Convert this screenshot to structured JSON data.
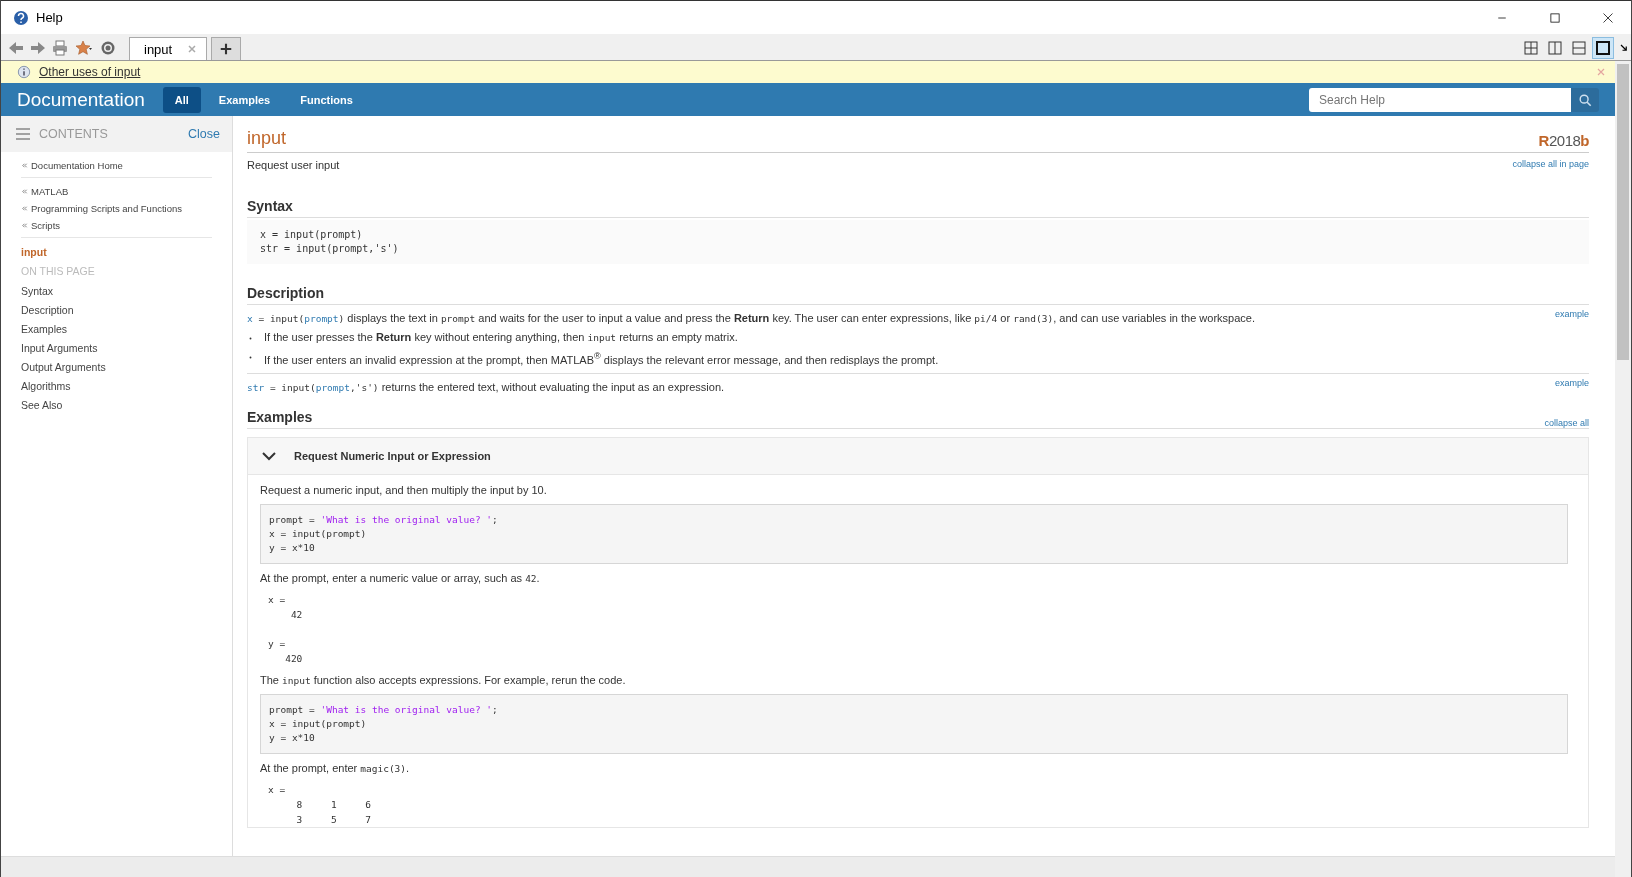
{
  "window": {
    "title": "Help"
  },
  "toolbar": {
    "tabs": [
      {
        "label": "input",
        "selected": true
      }
    ],
    "layouts": [
      {
        "kind": "grid",
        "selected": false
      },
      {
        "kind": "columns",
        "selected": false
      },
      {
        "kind": "rows",
        "selected": false
      },
      {
        "kind": "single",
        "selected": true
      }
    ]
  },
  "info_bar": {
    "link": "Other uses of input"
  },
  "header": {
    "title": "Documentation",
    "filters": [
      {
        "label": "All",
        "selected": true
      },
      {
        "label": "Examples",
        "selected": false
      },
      {
        "label": "Functions",
        "selected": false
      }
    ],
    "search": {
      "placeholder": "Search Help"
    }
  },
  "sidebar": {
    "title": "CONTENTS",
    "close": "Close",
    "breadcrumbs": [
      [
        {
          "label": "Documentation Home"
        }
      ],
      [
        {
          "label": "MATLAB"
        },
        {
          "label": "Programming Scripts and Functions"
        },
        {
          "label": "Scripts"
        }
      ]
    ],
    "current": "input",
    "section_label": "ON THIS PAGE",
    "items": [
      {
        "label": "Syntax"
      },
      {
        "label": "Description"
      },
      {
        "label": "Examples"
      },
      {
        "label": "Input Arguments"
      },
      {
        "label": "Output Arguments"
      },
      {
        "label": "Algorithms"
      },
      {
        "label": "See Also"
      }
    ]
  },
  "page": {
    "title": "input",
    "release": {
      "prefix": "R",
      "year": "2018",
      "suffix": "b"
    },
    "subtitle": "Request user input",
    "collapse_all_in_page": "collapse all in page",
    "syntax": {
      "heading": "Syntax",
      "lines": [
        "x = input(prompt)",
        "str = input(prompt,'s')"
      ]
    },
    "description": {
      "heading": "Description",
      "entries": [
        {
          "link": "example",
          "paragraph": [
            {
              "kind": "var",
              "text": "x"
            },
            {
              "kind": "code",
              "text": " = input("
            },
            {
              "kind": "var",
              "text": "prompt"
            },
            {
              "kind": "code",
              "text": ")"
            },
            {
              "kind": "text",
              "text": " displays the text in "
            },
            {
              "kind": "code",
              "text": "prompt"
            },
            {
              "kind": "text",
              "text": " and waits for the user to input a value and press the **Return** key. The user can enter expressions, like "
            },
            {
              "kind": "code",
              "text": "pi/4"
            },
            {
              "kind": "text",
              "text": " or "
            },
            {
              "kind": "code",
              "text": "rand(3)"
            },
            {
              "kind": "text",
              "text": ", and can use variables in the workspace."
            }
          ],
          "bullets": [
            [
              {
                "kind": "text",
                "text": "If the user presses the **Return** key without entering anything, then "
              },
              {
                "kind": "code",
                "text": "input"
              },
              {
                "kind": "text",
                "text": " returns an empty matrix."
              }
            ],
            [
              {
                "kind": "text",
                "text": "If the user enters an invalid expression at the prompt, then MATLAB$^{®}$ displays the relevant error message, and then redisplays the prompt."
              }
            ]
          ]
        },
        {
          "link": "example",
          "paragraph": [
            {
              "kind": "var",
              "text": "str"
            },
            {
              "kind": "code",
              "text": " = input("
            },
            {
              "kind": "var",
              "text": "prompt"
            },
            {
              "kind": "code",
              "text": ",'s')"
            },
            {
              "kind": "text",
              "text": " returns the entered text, without evaluating the input as an expression."
            }
          ]
        }
      ]
    },
    "examples": {
      "heading": "Examples",
      "collapse_all": "collapse all",
      "items": [
        {
          "title": "Request Numeric Input or Expression",
          "expanded": true,
          "blocks": [
            {
              "kind": "para",
              "segments": [
                {
                  "kind": "text",
                  "text": "Request a numeric input, and then multiply the input by 10."
                }
              ]
            },
            {
              "kind": "code",
              "lines": [
                [
                  {
                    "kind": "code",
                    "text": "prompt = "
                  },
                  {
                    "kind": "string",
                    "text": "'What is the original value? '"
                  },
                  {
                    "kind": "code",
                    "text": ";"
                  }
                ],
                [
                  {
                    "kind": "code",
                    "text": "x = input(prompt)"
                  }
                ],
                [
                  {
                    "kind": "code",
                    "text": "y = x*10"
                  }
                ]
              ]
            },
            {
              "kind": "para",
              "segments": [
                {
                  "kind": "text",
                  "text": "At the prompt, enter a numeric value or array, such as "
                },
                {
                  "kind": "code",
                  "text": "42"
                },
                {
                  "kind": "text",
                  "text": "."
                }
              ]
            },
            {
              "kind": "output",
              "groups": [
                [
                  "x =",
                  "    42"
                ],
                [
                  "y =",
                  "   420"
                ]
              ]
            },
            {
              "kind": "para",
              "segments": [
                {
                  "kind": "text",
                  "text": "The "
                },
                {
                  "kind": "code",
                  "text": "input"
                },
                {
                  "kind": "text",
                  "text": " function also accepts expressions. For example, rerun the code."
                }
              ]
            },
            {
              "kind": "code",
              "lines": [
                [
                  {
                    "kind": "code",
                    "text": "prompt = "
                  },
                  {
                    "kind": "string",
                    "text": "'What is the original value? '"
                  },
                  {
                    "kind": "code",
                    "text": ";"
                  }
                ],
                [
                  {
                    "kind": "code",
                    "text": "x = input(prompt)"
                  }
                ],
                [
                  {
                    "kind": "code",
                    "text": "y = x*10"
                  }
                ]
              ]
            },
            {
              "kind": "para",
              "segments": [
                {
                  "kind": "text",
                  "text": "At the prompt, enter "
                },
                {
                  "kind": "code",
                  "text": "magic(3)"
                },
                {
                  "kind": "text",
                  "text": "."
                }
              ]
            },
            {
              "kind": "output",
              "groups": [
                [
                  "x =",
                  "     8     1     6",
                  "     3     5     7"
                ]
              ]
            }
          ]
        }
      ]
    }
  }
}
